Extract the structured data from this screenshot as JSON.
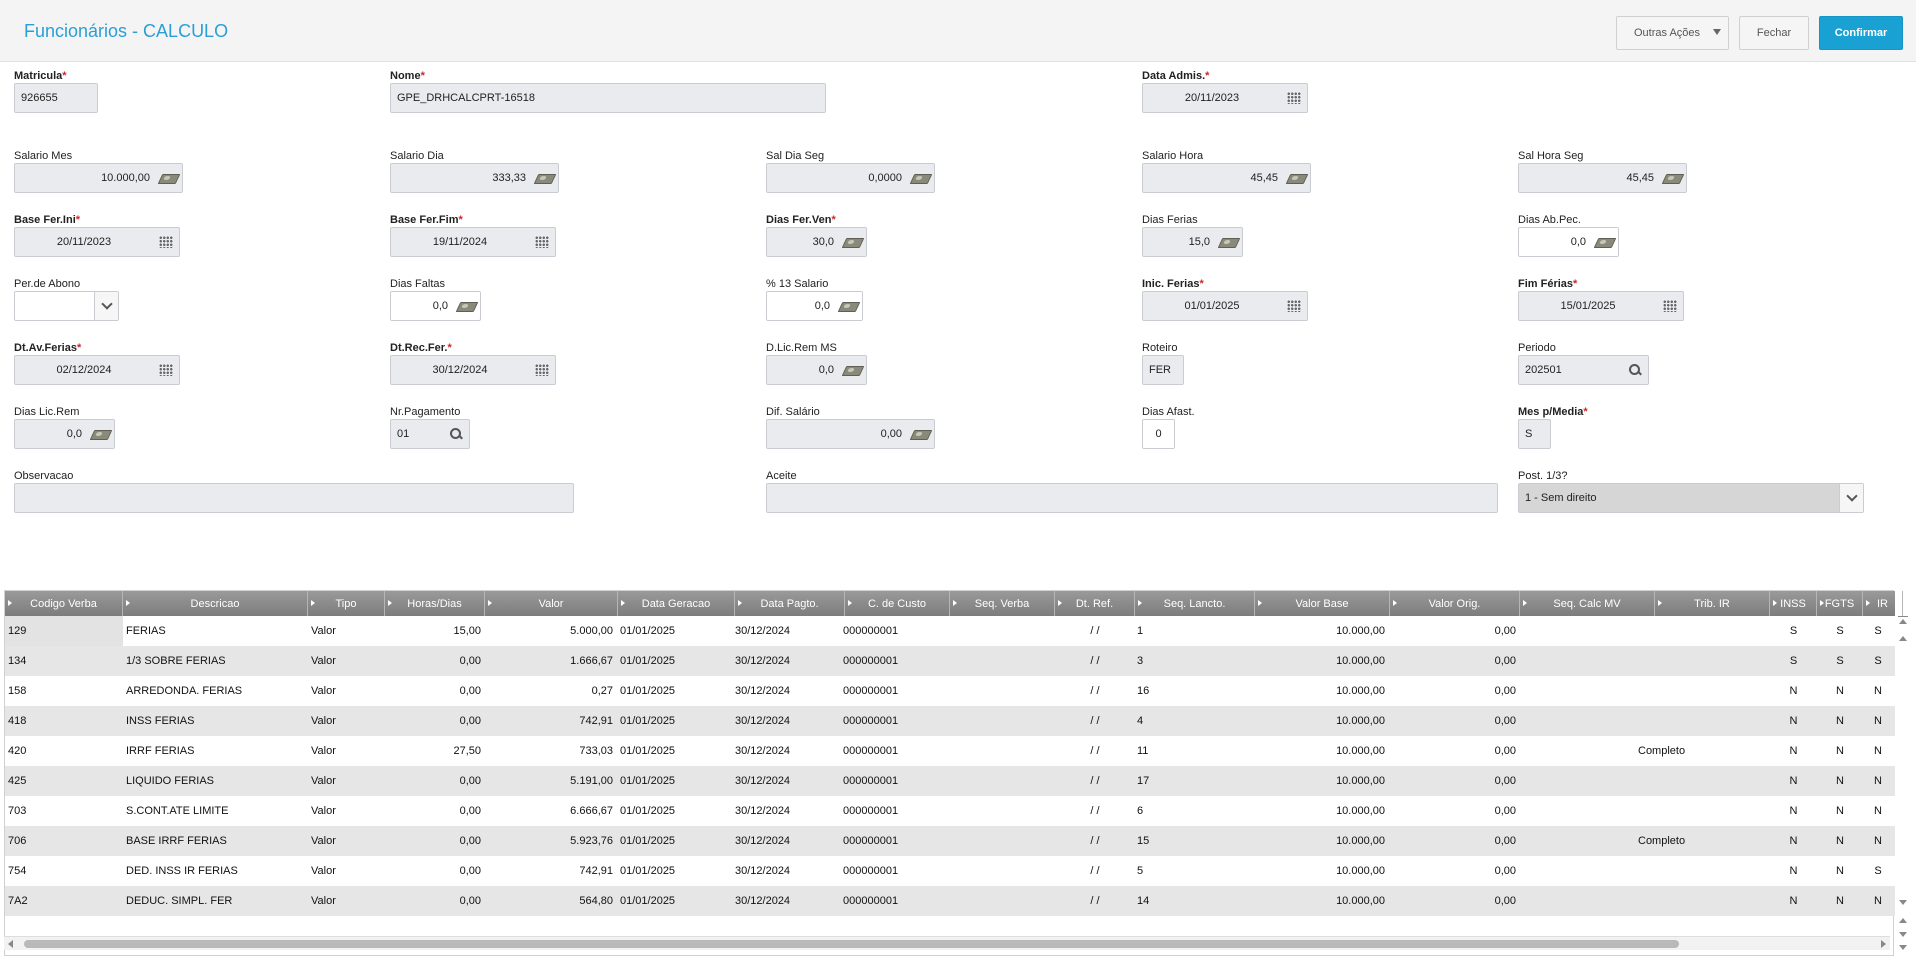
{
  "header": {
    "title": "Funcionários - CALCULO",
    "more_actions": "Outras Ações",
    "close": "Fechar",
    "confirm": "Confirmar"
  },
  "fields": {
    "matricula": {
      "label": "Matricula",
      "value": "926655"
    },
    "nome": {
      "label": "Nome",
      "value": "GPE_DRHCALCPRT-16518"
    },
    "data_admis": {
      "label": "Data Admis.",
      "value": "20/11/2023"
    },
    "salario_mes": {
      "label": "Salario Mes",
      "value": "10.000,00"
    },
    "salario_dia": {
      "label": "Salario Dia",
      "value": "333,33"
    },
    "sal_dia_seg": {
      "label": "Sal Dia Seg",
      "value": "0,0000"
    },
    "salario_hora": {
      "label": "Salario Hora",
      "value": "45,45"
    },
    "sal_hora_seg": {
      "label": "Sal Hora Seg",
      "value": "45,45"
    },
    "base_fer_ini": {
      "label": "Base Fer.Ini",
      "value": "20/11/2023"
    },
    "base_fer_fim": {
      "label": "Base Fer.Fim",
      "value": "19/11/2024"
    },
    "dias_fer_ven": {
      "label": "Dias Fer.Ven",
      "value": "30,0"
    },
    "dias_ferias": {
      "label": "Dias Ferias",
      "value": "15,0"
    },
    "dias_ab_pec": {
      "label": "Dias Ab.Pec.",
      "value": "0,0"
    },
    "per_abono": {
      "label": "Per.de Abono",
      "value": ""
    },
    "dias_faltas": {
      "label": "Dias Faltas",
      "value": "0,0"
    },
    "pct_13_salario": {
      "label": "% 13 Salario",
      "value": "0,0"
    },
    "inic_ferias": {
      "label": "Inic. Ferias",
      "value": "01/01/2025"
    },
    "fim_ferias": {
      "label": "Fim Férias",
      "value": "15/01/2025"
    },
    "dt_av_ferias": {
      "label": "Dt.Av.Ferias",
      "value": "02/12/2024"
    },
    "dt_rec_fer": {
      "label": "Dt.Rec.Fer.",
      "value": "30/12/2024"
    },
    "d_lic_rem_ms": {
      "label": "D.Lic.Rem MS",
      "value": "0,0"
    },
    "roteiro": {
      "label": "Roteiro",
      "value": "FER"
    },
    "periodo": {
      "label": "Periodo",
      "value": "202501"
    },
    "dias_lic_rem": {
      "label": "Dias Lic.Rem",
      "value": "0,0"
    },
    "nr_pagamento": {
      "label": "Nr.Pagamento",
      "value": "01"
    },
    "dif_salario": {
      "label": "Dif. Salário",
      "value": "0,00"
    },
    "dias_afast": {
      "label": "Dias Afast.",
      "value": "0"
    },
    "mes_p_media": {
      "label": "Mes p/Media",
      "value": "S"
    },
    "observacao": {
      "label": "Observacao",
      "value": ""
    },
    "aceite": {
      "label": "Aceite",
      "value": ""
    },
    "post_1_3": {
      "label": "Post. 1/3?",
      "value": "1 - Sem direito"
    }
  },
  "grid": {
    "columns": [
      "Codigo Verba",
      "Descricao",
      "Tipo",
      "Horas/Dias",
      "Valor",
      "Data Geracao",
      "Data Pagto.",
      "C. de Custo",
      "Seq. Verba",
      "Dt. Ref.",
      "Seq. Lancto.",
      "Valor Base",
      "Valor Orig.",
      "Seq. Calc MV",
      "Trib. IR",
      "INSS",
      "FGTS",
      "IR"
    ],
    "rows": [
      {
        "codigo": "129",
        "descricao": "FERIAS",
        "tipo": "Valor",
        "horas": "15,00",
        "valor": "5.000,00",
        "data_ger": "01/01/2025",
        "data_pag": "30/12/2024",
        "custo": "000000001",
        "seq_verba": "",
        "dt_ref": "/ /",
        "seq_lancto": "1",
        "valor_base": "10.000,00",
        "valor_orig": "0,00",
        "seq_calc": "",
        "trib_ir": "",
        "inss": "S",
        "fgts": "S",
        "ir": "S"
      },
      {
        "codigo": "134",
        "descricao": "1/3 SOBRE FERIAS",
        "tipo": "Valor",
        "horas": "0,00",
        "valor": "1.666,67",
        "data_ger": "01/01/2025",
        "data_pag": "30/12/2024",
        "custo": "000000001",
        "seq_verba": "",
        "dt_ref": "/ /",
        "seq_lancto": "3",
        "valor_base": "10.000,00",
        "valor_orig": "0,00",
        "seq_calc": "",
        "trib_ir": "",
        "inss": "S",
        "fgts": "S",
        "ir": "S"
      },
      {
        "codigo": "158",
        "descricao": "ARREDONDA. FERIAS",
        "tipo": "Valor",
        "horas": "0,00",
        "valor": "0,27",
        "data_ger": "01/01/2025",
        "data_pag": "30/12/2024",
        "custo": "000000001",
        "seq_verba": "",
        "dt_ref": "/ /",
        "seq_lancto": "16",
        "valor_base": "10.000,00",
        "valor_orig": "0,00",
        "seq_calc": "",
        "trib_ir": "",
        "inss": "N",
        "fgts": "N",
        "ir": "N"
      },
      {
        "codigo": "418",
        "descricao": "INSS FERIAS",
        "tipo": "Valor",
        "horas": "0,00",
        "valor": "742,91",
        "data_ger": "01/01/2025",
        "data_pag": "30/12/2024",
        "custo": "000000001",
        "seq_verba": "",
        "dt_ref": "/ /",
        "seq_lancto": "4",
        "valor_base": "10.000,00",
        "valor_orig": "0,00",
        "seq_calc": "",
        "trib_ir": "",
        "inss": "N",
        "fgts": "N",
        "ir": "N"
      },
      {
        "codigo": "420",
        "descricao": "IRRF FERIAS",
        "tipo": "Valor",
        "horas": "27,50",
        "valor": "733,03",
        "data_ger": "01/01/2025",
        "data_pag": "30/12/2024",
        "custo": "000000001",
        "seq_verba": "",
        "dt_ref": "/ /",
        "seq_lancto": "11",
        "valor_base": "10.000,00",
        "valor_orig": "0,00",
        "seq_calc": "",
        "trib_ir": "Completo",
        "inss": "N",
        "fgts": "N",
        "ir": "N"
      },
      {
        "codigo": "425",
        "descricao": "LIQUIDO FERIAS",
        "tipo": "Valor",
        "horas": "0,00",
        "valor": "5.191,00",
        "data_ger": "01/01/2025",
        "data_pag": "30/12/2024",
        "custo": "000000001",
        "seq_verba": "",
        "dt_ref": "/ /",
        "seq_lancto": "17",
        "valor_base": "10.000,00",
        "valor_orig": "0,00",
        "seq_calc": "",
        "trib_ir": "",
        "inss": "N",
        "fgts": "N",
        "ir": "N"
      },
      {
        "codigo": "703",
        "descricao": "S.CONT.ATE LIMITE",
        "tipo": "Valor",
        "horas": "0,00",
        "valor": "6.666,67",
        "data_ger": "01/01/2025",
        "data_pag": "30/12/2024",
        "custo": "000000001",
        "seq_verba": "",
        "dt_ref": "/ /",
        "seq_lancto": "6",
        "valor_base": "10.000,00",
        "valor_orig": "0,00",
        "seq_calc": "",
        "trib_ir": "",
        "inss": "N",
        "fgts": "N",
        "ir": "N"
      },
      {
        "codigo": "706",
        "descricao": "BASE IRRF FERIAS",
        "tipo": "Valor",
        "horas": "0,00",
        "valor": "5.923,76",
        "data_ger": "01/01/2025",
        "data_pag": "30/12/2024",
        "custo": "000000001",
        "seq_verba": "",
        "dt_ref": "/ /",
        "seq_lancto": "15",
        "valor_base": "10.000,00",
        "valor_orig": "0,00",
        "seq_calc": "",
        "trib_ir": "Completo",
        "inss": "N",
        "fgts": "N",
        "ir": "N"
      },
      {
        "codigo": "754",
        "descricao": "DED. INSS IR FERIAS",
        "tipo": "Valor",
        "horas": "0,00",
        "valor": "742,91",
        "data_ger": "01/01/2025",
        "data_pag": "30/12/2024",
        "custo": "000000001",
        "seq_verba": "",
        "dt_ref": "/ /",
        "seq_lancto": "5",
        "valor_base": "10.000,00",
        "valor_orig": "0,00",
        "seq_calc": "",
        "trib_ir": "",
        "inss": "N",
        "fgts": "N",
        "ir": "S"
      },
      {
        "codigo": "7A2",
        "descricao": "DEDUC. SIMPL. FER",
        "tipo": "Valor",
        "horas": "0,00",
        "valor": "564,80",
        "data_ger": "01/01/2025",
        "data_pag": "30/12/2024",
        "custo": "000000001",
        "seq_verba": "",
        "dt_ref": "/ /",
        "seq_lancto": "14",
        "valor_base": "10.000,00",
        "valor_orig": "0,00",
        "seq_calc": "",
        "trib_ir": "",
        "inss": "N",
        "fgts": "N",
        "ir": "N"
      }
    ]
  },
  "colors": {
    "title": "#2a9fd6",
    "confirm_button": "#1aa1d4",
    "required_star": "#d2232a",
    "grid_header": "#8a8a8a"
  }
}
